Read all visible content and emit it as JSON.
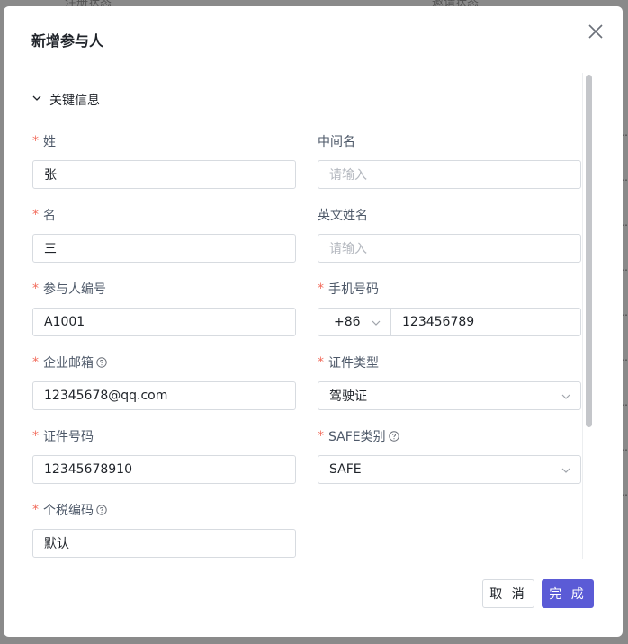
{
  "background": {
    "col1_header": "注册状态",
    "col2_header": "邀请状态"
  },
  "dialog": {
    "title": "新增参与人",
    "section": "关键信息",
    "fields": {
      "last_name": {
        "label": "姓",
        "value": "张"
      },
      "middle_name": {
        "label": "中间名",
        "placeholder": "请输入"
      },
      "first_name": {
        "label": "名",
        "value": "三"
      },
      "english_name": {
        "label": "英文姓名",
        "placeholder": "请输入"
      },
      "participant_no": {
        "label": "参与人编号",
        "value": "A1001"
      },
      "phone": {
        "label": "手机号码",
        "country_code": "+86",
        "value": "123456789"
      },
      "email": {
        "label": "企业邮箱",
        "value": "12345678@qq.com"
      },
      "id_type": {
        "label": "证件类型",
        "value": "驾驶证"
      },
      "id_number": {
        "label": "证件号码",
        "value": "12345678910"
      },
      "safe_type": {
        "label": "SAFE类别",
        "value": "SAFE"
      },
      "tax_code": {
        "label": "个税编码",
        "value": "默认"
      }
    },
    "required_mark": "*",
    "buttons": {
      "cancel": "取 消",
      "done": "完 成"
    }
  },
  "colors": {
    "accent": "#5b5bd6",
    "required": "#f26b5b",
    "border": "#d7dbe0"
  }
}
